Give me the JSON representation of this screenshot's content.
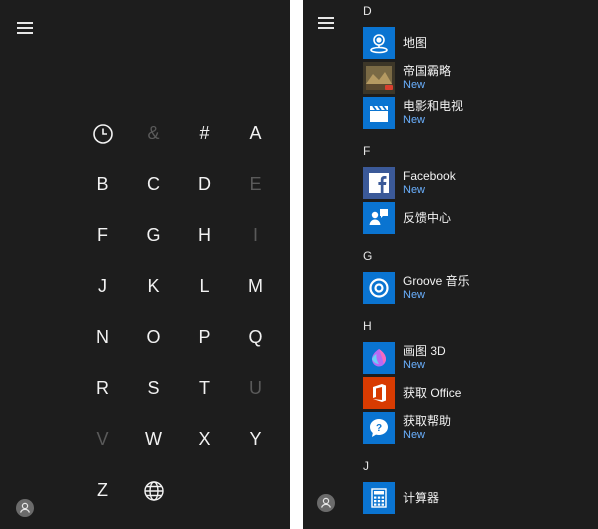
{
  "letter_grid": [
    {
      "label": "clock",
      "enabled": true,
      "icon": "clock-icon"
    },
    {
      "label": "&",
      "enabled": false
    },
    {
      "label": "#",
      "enabled": true
    },
    {
      "label": "A",
      "enabled": true
    },
    {
      "label": "B",
      "enabled": true
    },
    {
      "label": "C",
      "enabled": true
    },
    {
      "label": "D",
      "enabled": true
    },
    {
      "label": "E",
      "enabled": false
    },
    {
      "label": "F",
      "enabled": true
    },
    {
      "label": "G",
      "enabled": true
    },
    {
      "label": "H",
      "enabled": true
    },
    {
      "label": "I",
      "enabled": false
    },
    {
      "label": "J",
      "enabled": true
    },
    {
      "label": "K",
      "enabled": true
    },
    {
      "label": "L",
      "enabled": true
    },
    {
      "label": "M",
      "enabled": true
    },
    {
      "label": "N",
      "enabled": true
    },
    {
      "label": "O",
      "enabled": true
    },
    {
      "label": "P",
      "enabled": true
    },
    {
      "label": "Q",
      "enabled": true
    },
    {
      "label": "R",
      "enabled": true
    },
    {
      "label": "S",
      "enabled": true
    },
    {
      "label": "T",
      "enabled": true
    },
    {
      "label": "U",
      "enabled": false
    },
    {
      "label": "V",
      "enabled": false
    },
    {
      "label": "W",
      "enabled": true
    },
    {
      "label": "X",
      "enabled": true
    },
    {
      "label": "Y",
      "enabled": true
    },
    {
      "label": "Z",
      "enabled": true
    },
    {
      "label": "globe",
      "enabled": true,
      "icon": "globe-icon"
    }
  ],
  "app_list": {
    "sections": [
      {
        "letter": "D",
        "apps": [
          {
            "name": "地图",
            "new": "",
            "icon": "maps-icon",
            "tile_color": "#0a74d1"
          },
          {
            "name": "帝国霸略",
            "new": "New",
            "icon": "game-thumbnail-icon",
            "tile_color": "#4a4030"
          },
          {
            "name": "电影和电视",
            "new": "New",
            "icon": "clapperboard-icon",
            "tile_color": "#0a74d1"
          }
        ]
      },
      {
        "letter": "F",
        "apps": [
          {
            "name": "Facebook",
            "new": "New",
            "icon": "facebook-icon",
            "tile_color": "#3b5998"
          },
          {
            "name": "反馈中心",
            "new": "",
            "icon": "feedback-icon",
            "tile_color": "#0a74d1"
          }
        ]
      },
      {
        "letter": "G",
        "apps": [
          {
            "name": "Groove 音乐",
            "new": "New",
            "icon": "groove-icon",
            "tile_color": "#0a74d1"
          }
        ]
      },
      {
        "letter": "H",
        "apps": [
          {
            "name": "画图 3D",
            "new": "New",
            "icon": "paint3d-icon",
            "tile_color": "#0a74d1"
          },
          {
            "name": "获取 Office",
            "new": "",
            "icon": "office-icon",
            "tile_color": "#d83b01"
          },
          {
            "name": "获取帮助",
            "new": "New",
            "icon": "help-icon",
            "tile_color": "#0a74d1"
          }
        ]
      },
      {
        "letter": "J",
        "apps": [
          {
            "name": "计算器",
            "new": "",
            "icon": "calculator-icon",
            "tile_color": "#0a74d1"
          }
        ]
      }
    ]
  }
}
